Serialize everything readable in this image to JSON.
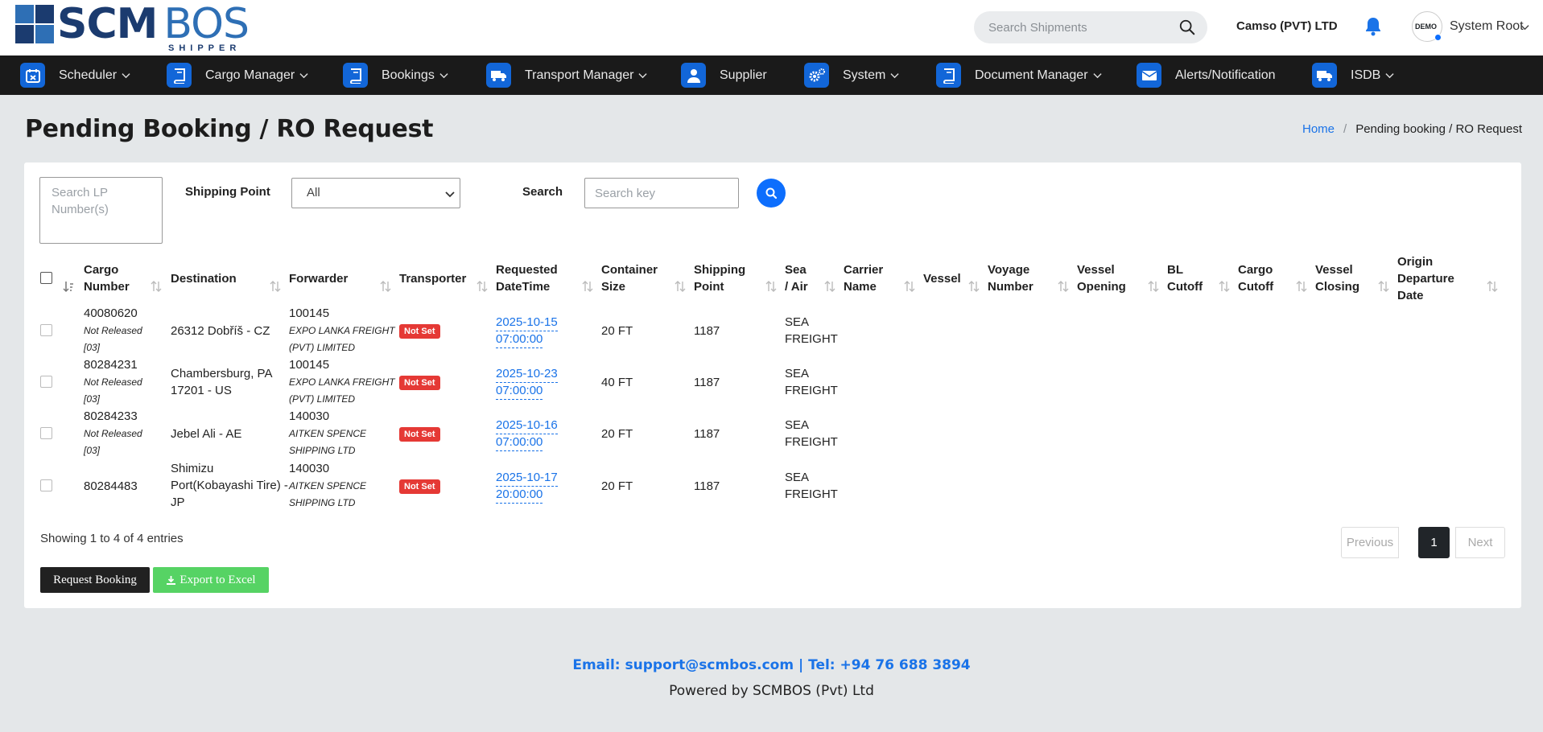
{
  "brand": {
    "main": "SCM",
    "accent": "BOS",
    "sub": "SHIPPER"
  },
  "header": {
    "search_placeholder": "Search Shipments",
    "company": "Camso (PVT) LTD",
    "avatar_text": "DEMO",
    "user": "System Root"
  },
  "nav": [
    {
      "label": "Scheduler",
      "icon": "calendar-icon"
    },
    {
      "label": "Cargo Manager",
      "icon": "book-icon"
    },
    {
      "label": "Bookings",
      "icon": "book-icon"
    },
    {
      "label": "Transport Manager",
      "icon": "truck-icon"
    },
    {
      "label": "Supplier",
      "icon": "user-icon"
    },
    {
      "label": "System",
      "icon": "gears-icon"
    },
    {
      "label": "Document Manager",
      "icon": "book-icon"
    },
    {
      "label": "Alerts/Notification",
      "icon": "envelope-icon"
    },
    {
      "label": "ISDB",
      "icon": "truck-icon"
    }
  ],
  "page": {
    "title": "Pending Booking / RO Request",
    "breadcrumb_home": "Home",
    "breadcrumb_sep": "/",
    "breadcrumb_current": "Pending booking / RO Request"
  },
  "filters": {
    "lp_placeholder": "Search LP Number(s)",
    "shipping_point_label": "Shipping Point",
    "shipping_point_value": "All",
    "search_label": "Search",
    "search_placeholder": "Search key"
  },
  "table": {
    "headers": {
      "cargo1": "Cargo",
      "cargo2": "Number",
      "destination": "Destination",
      "forwarder": "Forwarder",
      "transporter": "Transporter",
      "req1": "Requested",
      "req2": "DateTime",
      "cont1": "Container",
      "cont2": "Size",
      "ship1": "Shipping",
      "ship2": "Point",
      "sea1": "Sea",
      "sea2": "/ Air",
      "car1": "Carrier",
      "car2": "Name",
      "vessel": "Vessel",
      "voy1": "Voyage",
      "voy2": "Number",
      "vo1": "Vessel",
      "vo2": "Opening",
      "bl1": "BL",
      "bl2": "Cutoff",
      "cc1": "Cargo",
      "cc2": "Cutoff",
      "vc1": "Vessel",
      "vc2": "Closing",
      "od1": "Origin",
      "od2": "Departure",
      "od3": "Date"
    },
    "rows": [
      {
        "cargo": "40080620",
        "status1": "Not Released",
        "status2": "[03]",
        "dest1": "26312 Dobříš - CZ",
        "dest2": "",
        "dest3": "",
        "fwd_code": "100145",
        "fwd1": "EXPO LANKA FREIGHT",
        "fwd2": "(PVT) LIMITED",
        "transporter": "Not Set",
        "date": "2025-10-15",
        "time": "07:00:00",
        "container": "20 FT",
        "ship_point": "1187",
        "mode1": "SEA",
        "mode2": "FREIGHT"
      },
      {
        "cargo": "80284231",
        "status1": "Not Released",
        "status2": "[03]",
        "dest1": "Chambersburg, PA",
        "dest2": "17201 - US",
        "dest3": "",
        "fwd_code": "100145",
        "fwd1": "EXPO LANKA FREIGHT",
        "fwd2": "(PVT) LIMITED",
        "transporter": "Not Set",
        "date": "2025-10-23",
        "time": "07:00:00",
        "container": "40 FT",
        "ship_point": "1187",
        "mode1": "SEA",
        "mode2": "FREIGHT"
      },
      {
        "cargo": "80284233",
        "status1": "Not Released",
        "status2": "[03]",
        "dest1": "Jebel Ali - AE",
        "dest2": "",
        "dest3": "",
        "fwd_code": "140030",
        "fwd1": "AITKEN SPENCE",
        "fwd2": "SHIPPING LTD",
        "transporter": "Not Set",
        "date": "2025-10-16",
        "time": "07:00:00",
        "container": "20 FT",
        "ship_point": "1187",
        "mode1": "SEA",
        "mode2": "FREIGHT"
      },
      {
        "cargo": "80284483",
        "status1": "",
        "status2": "",
        "dest1": "Shimizu",
        "dest2": "Port(Kobayashi Tire) -",
        "dest3": "JP",
        "fwd_code": "140030",
        "fwd1": "AITKEN SPENCE",
        "fwd2": "SHIPPING LTD",
        "transporter": "Not Set",
        "date": "2025-10-17",
        "time": "20:00:00",
        "container": "20 FT",
        "ship_point": "1187",
        "mode1": "SEA",
        "mode2": "FREIGHT"
      }
    ]
  },
  "pagination": {
    "info": "Showing 1 to 4 of 4 entries",
    "previous": "Previous",
    "page": "1",
    "next": "Next"
  },
  "actions": {
    "request_booking": "Request Booking",
    "export_excel": "Export to Excel"
  },
  "footer": {
    "contact": "Email: support@scmbos.com | Tel: +94 76 688 3894",
    "powered": "Powered by SCMBOS (Pvt) Ltd"
  },
  "colors": {
    "nav_bg": "#1a1a1a",
    "accent": "#0d6efd",
    "badge": "#e53935",
    "export": "#56d364",
    "logo_dark": "#1b3b6f"
  }
}
